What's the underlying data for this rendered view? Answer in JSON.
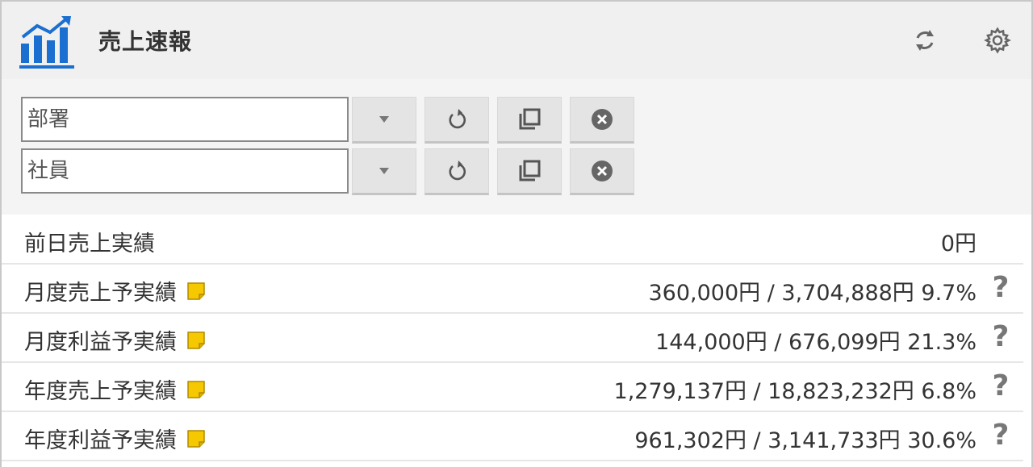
{
  "app": {
    "title": "売上速報",
    "icon": "bar-chart-growth-icon",
    "accent_color": "#1a6fd0"
  },
  "header_actions": {
    "refresh_icon": "refresh-icon",
    "settings_icon": "gear-icon"
  },
  "filters": {
    "department": {
      "placeholder": "部署",
      "value": ""
    },
    "employee": {
      "placeholder": "社員",
      "value": ""
    },
    "buttons": [
      "dropdown-arrow-icon",
      "reset-icon",
      "copy-icon",
      "clear-icon"
    ]
  },
  "metrics": [
    {
      "label": "前日売上実績",
      "has_memo": false,
      "value": "0円",
      "has_help": false
    },
    {
      "label": "月度売上予実績",
      "has_memo": true,
      "value": "360,000円 / 3,704,888円 9.7%",
      "has_help": true
    },
    {
      "label": "月度利益予実績",
      "has_memo": true,
      "value": "144,000円 / 676,099円 21.3%",
      "has_help": true
    },
    {
      "label": "年度売上予実績",
      "has_memo": true,
      "value": "1,279,137円 / 18,823,232円 6.8%",
      "has_help": true
    },
    {
      "label": "年度利益予実績",
      "has_memo": true,
      "value": "961,302円 / 3,141,733円 30.6%",
      "has_help": true
    }
  ],
  "help_glyph": "?",
  "memo_color": "#f5c800"
}
